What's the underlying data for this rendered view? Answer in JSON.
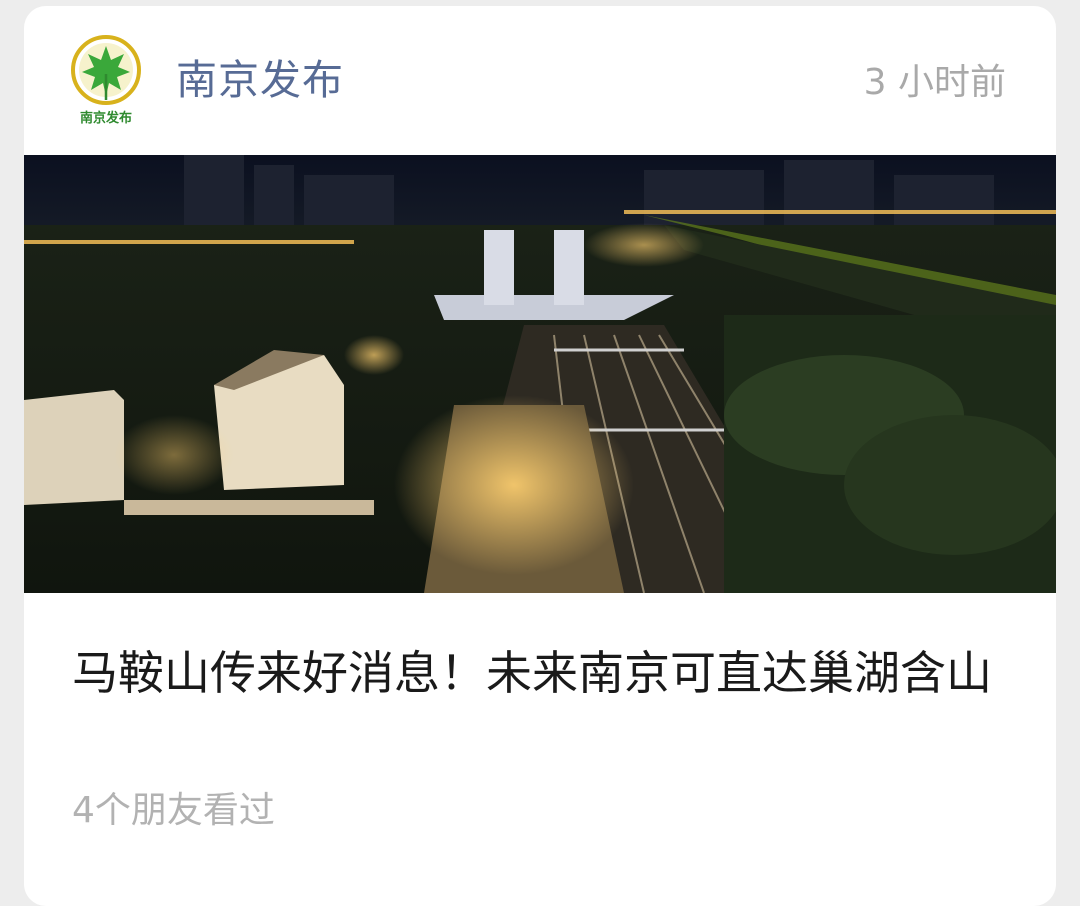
{
  "post": {
    "account_name": "南京发布",
    "logo_text": "南京发布",
    "time": "3 小时前",
    "title": "马鞍山传来好消息！未来南京可直达巢湖含山",
    "friends_viewed": "4个朋友看过",
    "cover_image": "night-aerial-railway-construction-photo"
  },
  "colors": {
    "card_bg": "#ffffff",
    "page_bg": "#ededed",
    "account_name": "#576b95",
    "title": "#1a1a1a",
    "meta": "#a9a9a9",
    "logo_green": "#3aa83a",
    "logo_gold": "#d8b21c"
  }
}
